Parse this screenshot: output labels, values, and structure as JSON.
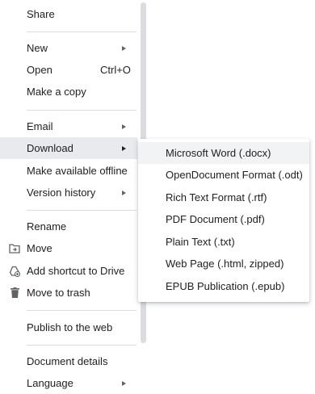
{
  "menu": {
    "share": "Share",
    "new": "New",
    "open": "Open",
    "open_shortcut": "Ctrl+O",
    "make_copy": "Make a copy",
    "email": "Email",
    "download": "Download",
    "make_offline": "Make available offline",
    "version_history": "Version history",
    "rename": "Rename",
    "move": "Move",
    "add_shortcut": "Add shortcut to Drive",
    "move_trash": "Move to trash",
    "publish": "Publish to the web",
    "document_details": "Document details",
    "language": "Language"
  },
  "download_submenu": {
    "items": [
      "Microsoft Word (.docx)",
      "OpenDocument Format (.odt)",
      "Rich Text Format (.rtf)",
      "PDF Document (.pdf)",
      "Plain Text (.txt)",
      "Web Page (.html, zipped)",
      "EPUB Publication (.epub)"
    ]
  },
  "colors": {
    "active_bg": "#e8eaed",
    "hover_bg": "#f1f3f4",
    "divider": "#dadce0",
    "text": "#202124",
    "icon": "#5f6368"
  },
  "icons": [
    "folder-move-icon",
    "add-to-drive-icon",
    "trash-icon",
    "submenu-arrow-icon"
  ]
}
